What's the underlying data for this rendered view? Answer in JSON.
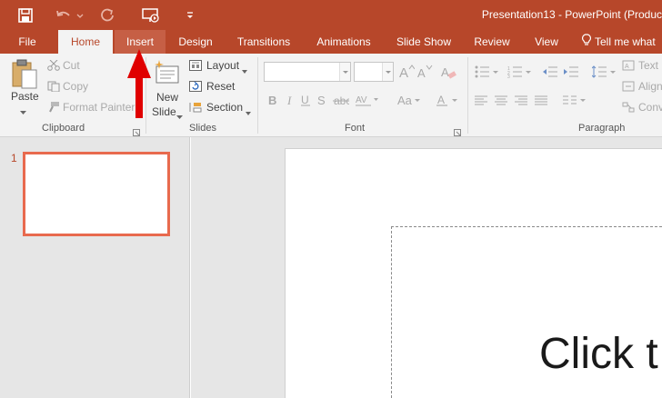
{
  "window": {
    "title": "Presentation13 - PowerPoint (Produc",
    "accent": "#b7472a"
  },
  "quick_access": [
    {
      "name": "save-icon"
    },
    {
      "name": "undo-icon"
    },
    {
      "name": "redo-icon"
    },
    {
      "name": "present-icon"
    },
    {
      "name": "customize-icon"
    }
  ],
  "tabs": [
    {
      "label": "File"
    },
    {
      "label": "Home"
    },
    {
      "label": "Insert"
    },
    {
      "label": "Design"
    },
    {
      "label": "Transitions"
    },
    {
      "label": "Animations"
    },
    {
      "label": "Slide Show"
    },
    {
      "label": "Review"
    },
    {
      "label": "View"
    },
    {
      "label": "Tell me what"
    }
  ],
  "ribbon": {
    "clipboard": {
      "paste": "Paste",
      "cut": "Cut",
      "copy": "Copy",
      "format_painter": "Format Painter",
      "label": "Clipboard"
    },
    "slides": {
      "new_slide_1": "New",
      "new_slide_2": "Slide",
      "layout": "Layout",
      "reset": "Reset",
      "section": "Section",
      "label": "Slides"
    },
    "font": {
      "font_name": "",
      "font_size": "",
      "label": "Font"
    },
    "paragraph": {
      "text_direction": "Text",
      "align_text": "Align",
      "convert": "Conv",
      "label": "Paragraph"
    }
  },
  "thumbnails": [
    {
      "number": "1"
    }
  ],
  "slide": {
    "title_placeholder": "Click t"
  },
  "annotation": {
    "arrow_color": "#e00000"
  }
}
